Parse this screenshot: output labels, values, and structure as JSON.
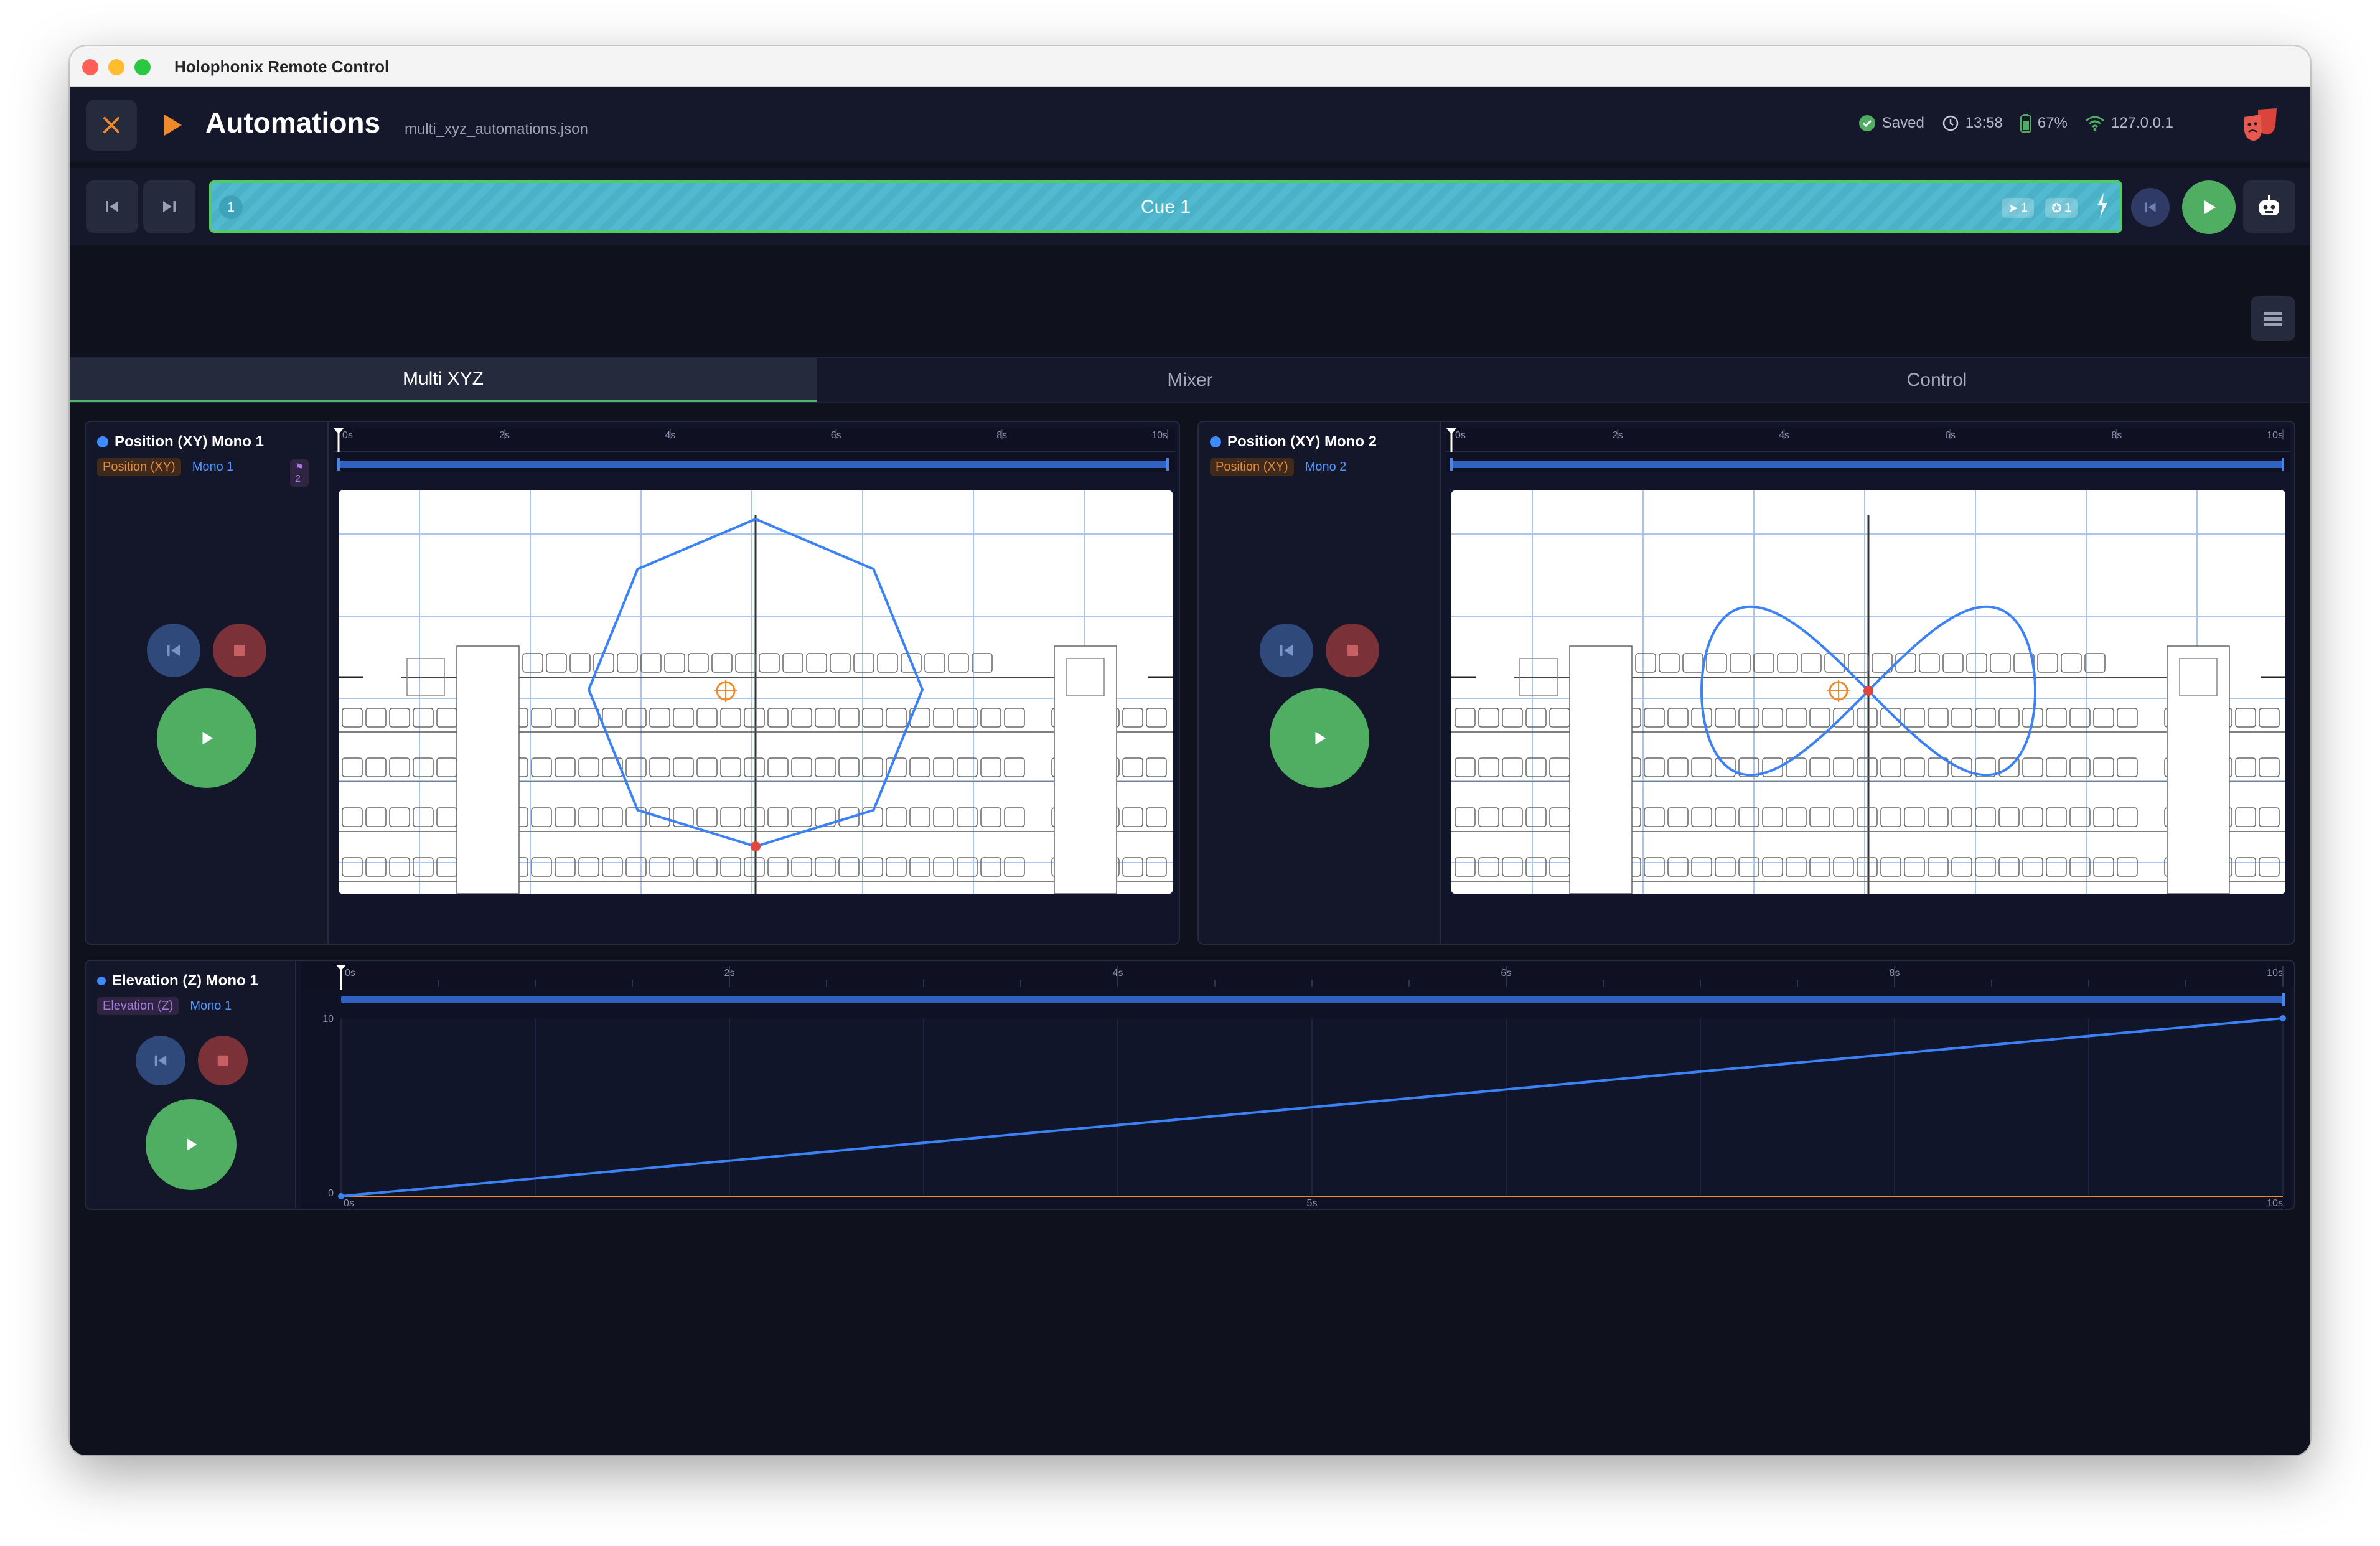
{
  "window": {
    "title": "Holophonix Remote Control"
  },
  "header": {
    "title": "Automations",
    "file": "multi_xyz_automations.json",
    "status": {
      "saved": "Saved",
      "time": "13:58",
      "battery": "67%",
      "ip": "127.0.0.1"
    }
  },
  "cuebar": {
    "cue_number": "1",
    "cue_label": "Cue 1",
    "badge1": "1",
    "badge2": "1"
  },
  "tabs": [
    {
      "label": "Multi XYZ"
    },
    {
      "label": "Mixer"
    },
    {
      "label": "Control"
    }
  ],
  "tracks": [
    {
      "title": "Position (XY) Mono 1",
      "type": "Position (XY)",
      "mono": "Mono 1",
      "flag": "2"
    },
    {
      "title": "Position (XY) Mono 2",
      "type": "Position (XY)",
      "mono": "Mono 2"
    },
    {
      "title": "Elevation (Z) Mono 1",
      "type": "Elevation (Z)",
      "mono": "Mono 1"
    }
  ],
  "timeline": {
    "ticks": [
      "0s",
      "2s",
      "4s",
      "6s",
      "8s",
      "10s"
    ]
  },
  "elevation_axis": {
    "y_ticks": [
      "10",
      "0"
    ],
    "x_ticks": [
      "0s",
      "5s",
      "10s"
    ]
  },
  "colors": {
    "accent_green": "#4fae62",
    "path_blue": "#3b82f6",
    "orange": "#f08a2a",
    "background": "#0f111c"
  },
  "icons": [
    "close-icon",
    "play-icon",
    "check-circle-icon",
    "clock-icon",
    "battery-icon",
    "wifi-icon",
    "theater-masks-icon",
    "skip-back-icon",
    "skip-forward-icon",
    "robot-icon",
    "list-icon",
    "stop-icon"
  ]
}
